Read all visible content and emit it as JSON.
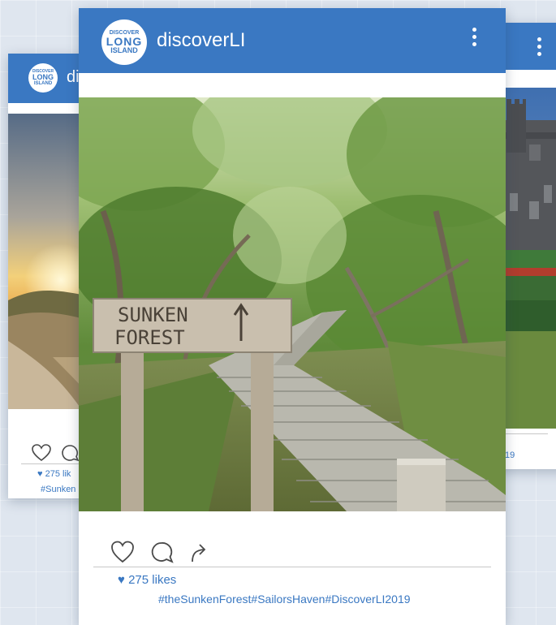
{
  "colors": {
    "brand": "#3a78c2",
    "header_text": "#ffffff",
    "likes": "#3a78c2"
  },
  "avatar_logo": {
    "line1": "DISCOVER",
    "line2": "LONG",
    "line3": "ISLAND"
  },
  "posts": {
    "left": {
      "username": "di",
      "likes_count": "275 lik",
      "hashtags": "#Sunken",
      "icons": [
        "heart-icon",
        "comment-icon"
      ]
    },
    "center": {
      "username": "discoverLI",
      "menu_icon": "kebab-icon",
      "photo_sign": {
        "line1": "SUNKEN",
        "line2": "FOREST"
      },
      "likes_count": "275 likes",
      "hashtags": "#theSunkenForest#SailorsHaven#DiscoverLI2019",
      "icons": [
        "heart-icon",
        "comment-icon",
        "share-icon"
      ]
    },
    "right": {
      "menu_icon": "kebab-icon",
      "hashtags": "19"
    }
  }
}
